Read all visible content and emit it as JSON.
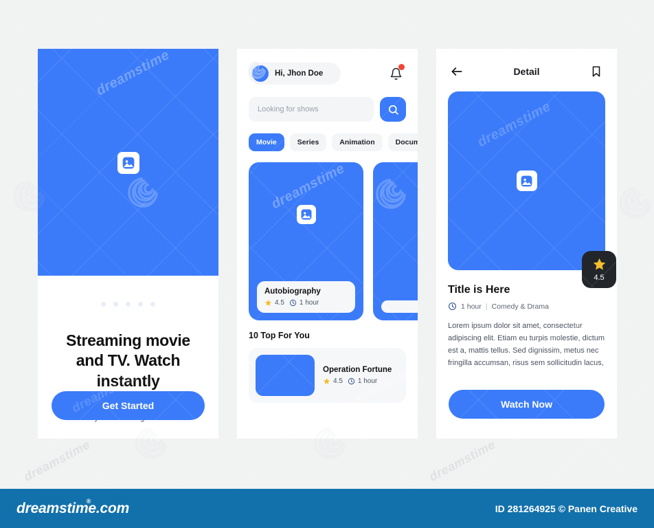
{
  "theme": {
    "brand_blue": "#3b7bfa",
    "page_bg": "#f1f2f2",
    "footer_bg": "#1271ab",
    "badge_dark": "#22262b",
    "star_yellow": "#f5bf2c",
    "alert_red": "#f04438"
  },
  "screen1": {
    "name": "onboarding",
    "hero_image_placeholder": "image-placeholder-icon",
    "pager_dots": 5,
    "active_dot_index": 0,
    "title": "Streaming movie and TV. Watch instantly",
    "subtitle": "Enjoy all your favourite films and TV shows on your streaming devices",
    "cta_label": "Get Started"
  },
  "screen2": {
    "name": "home",
    "greeting": "Hi, Jhon Doe",
    "avatar": "user-avatar",
    "notification_icon": "bell-icon",
    "has_notification": true,
    "search": {
      "value": "",
      "placeholder": "Looking for shows",
      "button_icon": "search-icon"
    },
    "chips": [
      {
        "label": "Movie",
        "active": true
      },
      {
        "label": "Series",
        "active": false
      },
      {
        "label": "Animation",
        "active": false
      },
      {
        "label": "Docum",
        "active": false
      }
    ],
    "cards": [
      {
        "title": "Autobiography",
        "rating": "4.5",
        "duration": "1 hour"
      },
      {
        "title": "",
        "rating": "",
        "duration": ""
      }
    ],
    "section_title": "10 Top For You",
    "list": [
      {
        "title": "Operation Fortune",
        "rating": "4.5",
        "duration": "1 hour"
      }
    ]
  },
  "screen3": {
    "name": "detail",
    "back_icon": "arrow-left-icon",
    "title": "Detail",
    "bookmark_icon": "bookmark-icon",
    "hero_image_placeholder": "image-placeholder-icon",
    "rating_badge": {
      "icon": "star-icon",
      "value": "4.5"
    },
    "movie_title": "Title is Here",
    "duration": "1 hour",
    "separator": "|",
    "genre": "Comedy & Drama",
    "description": "Lorem ipsum dolor sit amet, consectetur adipiscing elit. Etiam eu turpis molestie, dictum est a, mattis tellus. Sed dignissim, metus nec fringilla accumsan, risus sem sollicitudin lacus,",
    "cta_label": "Watch Now"
  },
  "footer": {
    "logo_text": "dreamstime.com",
    "registered_mark": "®",
    "credit": "ID 281264925 © Panen Creative"
  },
  "watermark": {
    "text": "dreamstime"
  }
}
